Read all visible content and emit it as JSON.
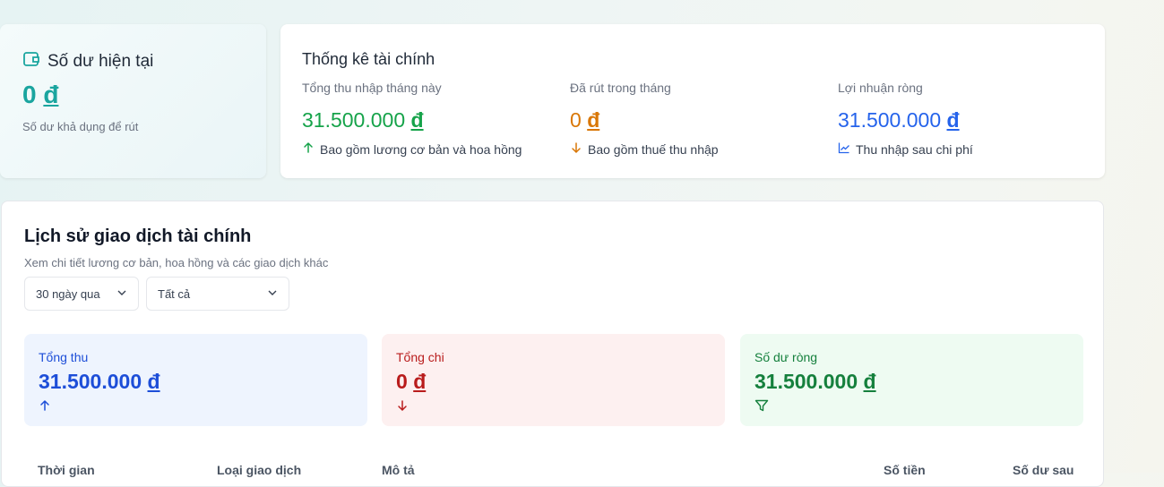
{
  "balance": {
    "title": "Số dư hiện tại",
    "amount": "0",
    "currency": "đ",
    "subtitle": "Số dư khả dụng để rút"
  },
  "stats": {
    "title": "Thống kê tài chính",
    "items": [
      {
        "label": "Tổng thu nhập tháng này",
        "value": "31.500.000",
        "currency": "đ",
        "note": "Bao gồm lương cơ bản và hoa hồng",
        "color": "#16a34a",
        "icon": "arrow-up-icon"
      },
      {
        "label": "Đã rút trong tháng",
        "value": "0",
        "currency": "đ",
        "note": "Bao gồm thuế thu nhập",
        "color": "#d97706",
        "icon": "arrow-down-icon"
      },
      {
        "label": "Lợi nhuận ròng",
        "value": "31.500.000",
        "currency": "đ",
        "note": "Thu nhập sau chi phí",
        "color": "#2563eb",
        "icon": "line-chart-icon"
      }
    ]
  },
  "history": {
    "title": "Lịch sử giao dịch tài chính",
    "subtitle": "Xem chi tiết lương cơ bản, hoa hồng và các giao dịch khác",
    "filters": {
      "period": "30 ngày qua",
      "type": "Tất cả"
    },
    "summary": [
      {
        "label": "Tổng thu",
        "value": "31.500.000",
        "currency": "đ",
        "bg": "#eef4fe",
        "color": "#1d4ed8",
        "icon": "arrow-up-icon"
      },
      {
        "label": "Tổng chi",
        "value": "0",
        "currency": "đ",
        "bg": "#fdf0f0",
        "color": "#b91c1c",
        "icon": "arrow-down-icon"
      },
      {
        "label": "Số dư ròng",
        "value": "31.500.000",
        "currency": "đ",
        "bg": "#eefbf2",
        "color": "#15803d",
        "icon": "filter-icon"
      }
    ],
    "columns": [
      "Thời gian",
      "Loại giao dịch",
      "Mô tả",
      "Số tiền",
      "Số dư sau"
    ]
  }
}
